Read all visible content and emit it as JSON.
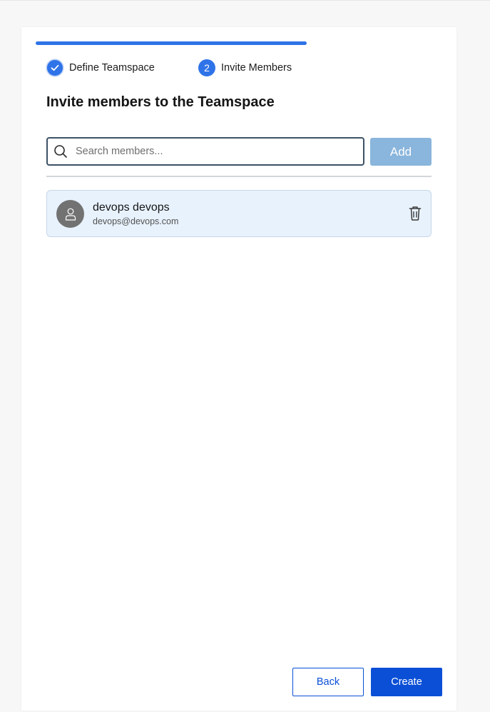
{
  "stepper": {
    "progress": 1.0,
    "steps": [
      {
        "label": "Define Teamspace",
        "status": "completed"
      },
      {
        "label": "Invite Members",
        "number": "2",
        "status": "current"
      }
    ]
  },
  "heading": "Invite members to the Teamspace",
  "search": {
    "placeholder": "Search members...",
    "value": "",
    "icon": "search-icon"
  },
  "add_label": "Add",
  "members": [
    {
      "name": "devops devops",
      "email": "devops@devops.com",
      "avatar_icon": "user-icon",
      "action_icon": "trash-icon"
    }
  ],
  "footer": {
    "back_label": "Back",
    "create_label": "Create"
  },
  "colors": {
    "accent": "#2f73e8",
    "primary_button": "#0b4fd6",
    "add_button_disabled": "#8ab5dc",
    "member_row_bg": "#e8f2fd"
  }
}
